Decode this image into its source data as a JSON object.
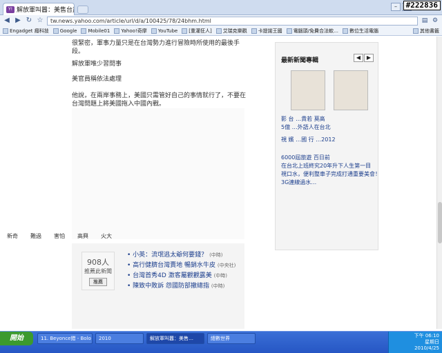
{
  "browser": {
    "tab_title": "解放軍叫囂：美售台武器…",
    "tab_favicon": "Y!",
    "url": "tw.news.yahoo.com/article/url/d/a/100425/78/24bhm.html",
    "stamp": "#222836"
  },
  "bookmarks": [
    {
      "label": "Engadget 癮科技"
    },
    {
      "label": "Google"
    },
    {
      "label": "Mobile01"
    },
    {
      "label": "Yahoo!奇摩"
    },
    {
      "label": "YouTube"
    },
    {
      "label": "[重灌狂人]"
    },
    {
      "label": "艾瑞克樂觀"
    },
    {
      "label": "卡提諾王國"
    },
    {
      "label": "電腦頭/免費合法軟…"
    },
    {
      "label": "數位生活電腦"
    }
  ],
  "bookmarks_other": "其他書籤",
  "article": {
    "p1": "很緊密，軍事力量只是在台灣勢力進行冒險時所使用的最後手段。",
    "h1": "解放軍唯少習問事",
    "h2": "美官員稱依法處理",
    "p2": "他說，在兩岸事務上，美國只需管好自己的事情就行了，不要在台灣問題上將美國拖入中國內戰。"
  },
  "sidebar": {
    "heading": "最新新聞專輯",
    "links": [
      "影  台 …貴若  莫高",
      "5億 …外語人在台北",
      "視  嬪 …國 行 …2012"
    ],
    "news": [
      "6000屆旅遊  百日前",
      "在台北上班終究20年升下人生第一目",
      "視口水，便利整車子完成打通重要美會！",
      "3G連線過水…"
    ]
  },
  "comments": {
    "count": "908人",
    "count_label": "推薦此新聞",
    "recommend_btn": "推薦",
    "links": [
      {
        "text": "小英：流氓逃太爺何要錢？",
        "src": "(中時)"
      },
      {
        "text": "高行健臍台灣賣地 暢銷水牛皮",
        "src": "(中央社)"
      },
      {
        "text": "台灣首秀4D 激客屬觀觀露美",
        "src": "(中時)"
      },
      {
        "text": "陳致中敗訴 怨國防部撤總指",
        "src": "(中時)"
      }
    ],
    "vote_labels": [
      "新奇",
      "難過",
      "害怕",
      "高興",
      "火大"
    ]
  },
  "taskbar": {
    "start": "開始",
    "tasks": [
      "11. Beyonce錯 - Bolo …",
      "2010",
      "解放軍叫囂：美售…",
      "總數世界"
    ],
    "time": "下午 06:10",
    "day": "星期日",
    "date": "2010/4/25"
  }
}
